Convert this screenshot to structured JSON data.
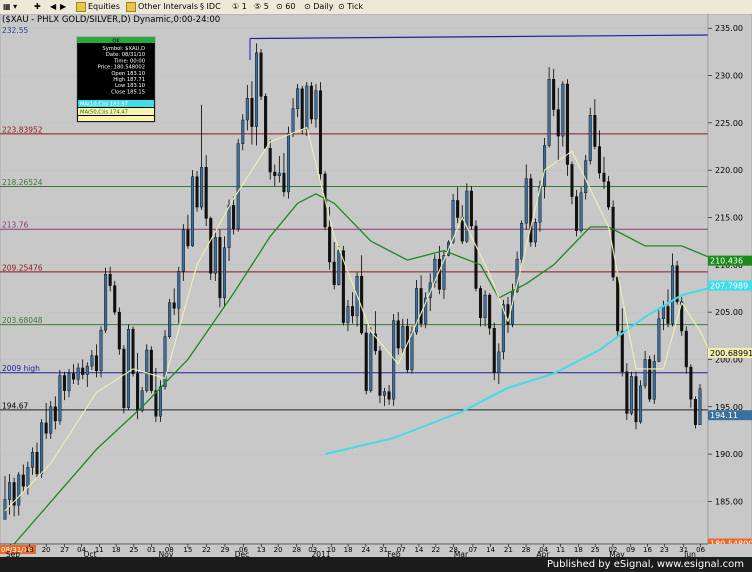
{
  "toolbar": {
    "items": [
      "Equities",
      "Other Intervals",
      "IDC",
      "1",
      "5",
      "60",
      "Daily",
      "Tick"
    ]
  },
  "chart_title": "($XAU - PHLX GOLD/SILVER,D) Dynamic,0:00-24:00",
  "footer": "Published by eSignal, www.esignal.com",
  "colors": {
    "background": "#c8c8c8",
    "up_candle": "#3a6f9e",
    "down_candle": "#111111",
    "ma10": "#f2eeb0",
    "ma50": "#1a8a1a",
    "ma200": "#40dce8",
    "fib_red": "#8b1a1a",
    "fib_green": "#3c7a3c",
    "fib_purple": "#8a3a7a",
    "blue_line": "#2020a0",
    "black_line": "#202020"
  },
  "data_window": {
    "header": "OK",
    "rows": [
      "Symbol: $XAU,D",
      "Date: 08/31/10",
      "Time: 00:00",
      "Price: 180.548002",
      "Open 183.10",
      "High 187.71",
      "Low 183.10",
      "Close 185.15"
    ],
    "ma10_label": "MA(10,C)is 183.97",
    "ma50_label": "MA(50,C)is 174.47"
  },
  "chart_data": {
    "type": "candlestick",
    "y_range": [
      180.5,
      236.5
    ],
    "y_ticks": [
      "185.00",
      "190.00",
      "195.00",
      "200.00",
      "205.00",
      "210.00",
      "215.00",
      "220.00",
      "225.00",
      "230.00",
      "235.00"
    ],
    "x_day_labels": [
      "08/31/10",
      "13",
      "20",
      "27",
      "04",
      "11",
      "18",
      "25",
      "01",
      "08",
      "15",
      "22",
      "29",
      "06",
      "13",
      "20",
      "28",
      "03",
      "10",
      "18",
      "24",
      "31",
      "07",
      "14",
      "22",
      "28",
      "07",
      "14",
      "21",
      "28",
      "04",
      "11",
      "18",
      "25",
      "02",
      "09",
      "16",
      "23",
      "31",
      "06"
    ],
    "x_month_labels": [
      "Sep",
      "Oct",
      "Nov",
      "Dec",
      "2011",
      "Feb",
      "Mar",
      "Apr",
      "May",
      "Jun"
    ],
    "horizontal_lines": [
      {
        "label": "223.83952",
        "value": 223.84,
        "kind": "fib_red"
      },
      {
        "label": "218.26524",
        "value": 218.27,
        "kind": "fib_green"
      },
      {
        "label": "213.76",
        "value": 213.76,
        "kind": "fib_purple"
      },
      {
        "label": "209.25476",
        "value": 209.25,
        "kind": "fib_red"
      },
      {
        "label": "203.68048",
        "value": 203.68,
        "kind": "fib_green"
      },
      {
        "label": "2009 high",
        "value": 198.6,
        "kind": "blue_line"
      },
      {
        "label": "194.67",
        "value": 194.67,
        "kind": "black_line"
      }
    ],
    "top_label": "232.55",
    "right_price_labels": [
      {
        "label": "210.436",
        "value": 210.44,
        "kind": "ma50"
      },
      {
        "label": "207.7989",
        "value": 207.8,
        "kind": "ma200"
      },
      {
        "label": "200.68991",
        "value": 200.69,
        "kind": "ma10"
      },
      {
        "label": "194.11",
        "value": 194.11,
        "kind": "up_candle"
      },
      {
        "label": "180.548002",
        "value": 180.55,
        "kind": "current"
      }
    ],
    "candles": [
      [
        183.1,
        187.7,
        183.1,
        185.2
      ],
      [
        185.2,
        187.9,
        183.6,
        187.0
      ],
      [
        187.0,
        187.5,
        183.4,
        184.6
      ],
      [
        184.6,
        188.1,
        183.5,
        187.8
      ],
      [
        187.8,
        188.9,
        186.0,
        186.6
      ],
      [
        186.6,
        189.2,
        185.7,
        188.6
      ],
      [
        188.6,
        190.7,
        187.8,
        190.2
      ],
      [
        190.2,
        191.2,
        187.4,
        187.9
      ],
      [
        187.9,
        193.7,
        187.5,
        193.3
      ],
      [
        193.3,
        195.4,
        191.6,
        192.2
      ],
      [
        192.2,
        195.6,
        191.6,
        195.0
      ],
      [
        195.0,
        196.1,
        192.6,
        193.5
      ],
      [
        193.5,
        198.9,
        193.1,
        198.3
      ],
      [
        198.3,
        198.7,
        195.7,
        196.7
      ],
      [
        196.7,
        199.0,
        196.0,
        198.5
      ],
      [
        198.5,
        199.5,
        197.4,
        197.9
      ],
      [
        197.9,
        199.6,
        197.3,
        199.1
      ],
      [
        199.1,
        200.0,
        197.9,
        198.4
      ],
      [
        198.4,
        199.7,
        197.1,
        199.3
      ],
      [
        199.3,
        201.0,
        198.9,
        200.4
      ],
      [
        200.4,
        201.6,
        198.1,
        198.8
      ],
      [
        198.8,
        203.5,
        198.1,
        203.1
      ],
      [
        203.1,
        209.7,
        202.8,
        209.0
      ],
      [
        209.0,
        209.8,
        207.2,
        207.8
      ],
      [
        207.8,
        208.3,
        204.7,
        205.0
      ],
      [
        205.0,
        205.5,
        200.5,
        201.1
      ],
      [
        201.1,
        201.5,
        194.3,
        194.9
      ],
      [
        194.9,
        203.7,
        194.7,
        203.2
      ],
      [
        203.2,
        203.5,
        198.2,
        198.5
      ],
      [
        198.5,
        200.7,
        193.7,
        194.6
      ],
      [
        194.6,
        197.1,
        194.4,
        196.7
      ],
      [
        196.7,
        201.6,
        196.5,
        201.0
      ],
      [
        201.0,
        201.4,
        196.4,
        196.7
      ],
      [
        196.7,
        199.1,
        193.4,
        194.0
      ],
      [
        194.0,
        197.8,
        193.4,
        197.1
      ],
      [
        197.1,
        203.1,
        196.8,
        202.4
      ],
      [
        202.4,
        206.4,
        202.2,
        206.0
      ],
      [
        206.0,
        207.5,
        204.7,
        205.4
      ],
      [
        205.4,
        209.8,
        203.8,
        209.3
      ],
      [
        209.3,
        214.3,
        208.3,
        213.7
      ],
      [
        213.7,
        215.3,
        211.7,
        212.0
      ],
      [
        212.0,
        220.0,
        211.9,
        219.3
      ],
      [
        219.3,
        219.9,
        215.6,
        216.1
      ],
      [
        216.1,
        226.9,
        215.8,
        220.3
      ],
      [
        220.3,
        221.6,
        214.1,
        214.9
      ],
      [
        214.9,
        215.1,
        208.4,
        209.1
      ],
      [
        209.1,
        213.7,
        208.3,
        212.9
      ],
      [
        212.9,
        213.7,
        205.5,
        206.5
      ],
      [
        206.5,
        213.0,
        205.5,
        211.8
      ],
      [
        211.8,
        216.9,
        210.4,
        216.3
      ],
      [
        216.3,
        217.2,
        213.2,
        213.8
      ],
      [
        213.8,
        223.3,
        213.5,
        222.8
      ],
      [
        222.8,
        225.9,
        222.1,
        225.3
      ],
      [
        225.3,
        229.0,
        224.2,
        227.6
      ],
      [
        227.6,
        229.4,
        222.7,
        224.6
      ],
      [
        224.6,
        233.4,
        222.6,
        232.4
      ],
      [
        232.4,
        232.8,
        227.4,
        227.8
      ],
      [
        227.8,
        228.1,
        222.2,
        222.3
      ],
      [
        222.3,
        223.2,
        219.0,
        219.8
      ],
      [
        219.8,
        220.6,
        218.3,
        219.4
      ],
      [
        219.4,
        221.5,
        218.7,
        219.7
      ],
      [
        219.7,
        221.8,
        217.2,
        217.7
      ],
      [
        217.7,
        224.6,
        217.0,
        223.9
      ],
      [
        223.9,
        227.6,
        223.5,
        226.5
      ],
      [
        226.5,
        229.1,
        225.6,
        228.6
      ],
      [
        228.6,
        228.9,
        223.8,
        224.3
      ],
      [
        224.3,
        229.3,
        223.6,
        228.9
      ],
      [
        228.9,
        229.3,
        224.9,
        225.4
      ],
      [
        225.4,
        229.1,
        224.5,
        228.4
      ],
      [
        228.4,
        229.3,
        218.7,
        219.6
      ],
      [
        219.6,
        219.9,
        213.7,
        214.0
      ],
      [
        214.0,
        216.1,
        209.5,
        210.3
      ],
      [
        210.3,
        212.4,
        207.4,
        207.9
      ],
      [
        207.9,
        212.0,
        207.8,
        211.5
      ],
      [
        211.5,
        212.0,
        203.6,
        203.9
      ],
      [
        203.9,
        206.3,
        203.0,
        205.6
      ],
      [
        205.6,
        207.1,
        203.8,
        204.6
      ],
      [
        204.6,
        209.2,
        203.5,
        208.8
      ],
      [
        208.8,
        211.0,
        202.6,
        202.8
      ],
      [
        202.8,
        203.7,
        196.3,
        196.7
      ],
      [
        196.7,
        203.4,
        196.5,
        202.7
      ],
      [
        202.7,
        205.1,
        200.5,
        200.9
      ],
      [
        200.9,
        201.4,
        195.4,
        196.2
      ],
      [
        196.2,
        197.0,
        195.1,
        196.6
      ],
      [
        196.6,
        197.3,
        195.2,
        195.8
      ],
      [
        195.8,
        204.8,
        195.1,
        204.1
      ],
      [
        204.1,
        205.0,
        200.5,
        201.2
      ],
      [
        201.2,
        204.3,
        200.6,
        203.5
      ],
      [
        203.5,
        204.3,
        198.6,
        198.9
      ],
      [
        198.9,
        203.5,
        198.5,
        202.9
      ],
      [
        202.9,
        208.4,
        202.6,
        207.5
      ],
      [
        207.5,
        208.9,
        203.4,
        203.8
      ],
      [
        203.8,
        207.1,
        203.3,
        206.5
      ],
      [
        206.5,
        209.1,
        205.1,
        208.1
      ],
      [
        208.1,
        211.1,
        207.6,
        210.6
      ],
      [
        210.6,
        212.0,
        206.9,
        207.4
      ],
      [
        207.4,
        211.4,
        206.4,
        211.0
      ],
      [
        211.0,
        212.6,
        210.9,
        212.4
      ],
      [
        212.4,
        217.5,
        212.2,
        216.8
      ],
      [
        216.8,
        218.2,
        214.4,
        215.0
      ],
      [
        215.0,
        216.3,
        212.2,
        212.5
      ],
      [
        212.5,
        218.6,
        212.3,
        217.8
      ],
      [
        217.8,
        218.3,
        213.7,
        214.1
      ],
      [
        214.1,
        214.7,
        207.2,
        207.5
      ],
      [
        207.5,
        207.8,
        203.5,
        204.4
      ],
      [
        204.4,
        207.3,
        203.5,
        206.8
      ],
      [
        206.8,
        207.0,
        202.6,
        203.3
      ],
      [
        203.3,
        203.9,
        197.8,
        198.6
      ],
      [
        198.6,
        201.7,
        197.4,
        200.8
      ],
      [
        200.8,
        206.3,
        200.0,
        205.8
      ],
      [
        205.8,
        206.6,
        202.8,
        203.7
      ],
      [
        203.7,
        208.0,
        203.4,
        207.2
      ],
      [
        207.2,
        211.4,
        207.0,
        210.6
      ],
      [
        210.6,
        214.7,
        209.9,
        214.4
      ],
      [
        214.4,
        220.6,
        213.7,
        219.1
      ],
      [
        219.1,
        219.6,
        211.9,
        212.4
      ],
      [
        212.4,
        214.9,
        211.9,
        214.5
      ],
      [
        214.5,
        218.9,
        213.5,
        218.3
      ],
      [
        218.3,
        223.4,
        217.0,
        222.6
      ],
      [
        222.6,
        230.9,
        222.4,
        229.6
      ],
      [
        229.6,
        230.7,
        225.7,
        226.4
      ],
      [
        226.4,
        228.7,
        220.9,
        223.6
      ],
      [
        223.6,
        229.4,
        222.5,
        229.1
      ],
      [
        229.1,
        229.6,
        219.4,
        220.6
      ],
      [
        220.6,
        220.9,
        216.4,
        217.2
      ],
      [
        217.2,
        217.9,
        213.0,
        213.6
      ],
      [
        213.6,
        218.2,
        213.4,
        217.6
      ],
      [
        217.6,
        221.6,
        216.9,
        221.0
      ],
      [
        221.0,
        226.6,
        220.6,
        225.8
      ],
      [
        225.8,
        227.5,
        222.2,
        222.5
      ],
      [
        222.5,
        224.2,
        219.1,
        219.7
      ],
      [
        219.7,
        221.4,
        218.0,
        218.8
      ],
      [
        218.8,
        219.4,
        215.8,
        216.1
      ],
      [
        216.1,
        216.8,
        208.3,
        208.7
      ],
      [
        208.7,
        209.1,
        202.4,
        203.0
      ],
      [
        203.0,
        205.4,
        198.2,
        198.7
      ],
      [
        198.7,
        199.6,
        193.6,
        194.3
      ],
      [
        194.3,
        198.7,
        194.1,
        198.2
      ],
      [
        198.2,
        198.7,
        192.6,
        193.4
      ],
      [
        193.4,
        197.8,
        193.2,
        197.2
      ],
      [
        197.2,
        200.9,
        196.9,
        200.0
      ],
      [
        200.0,
        200.4,
        195.5,
        195.8
      ],
      [
        195.8,
        200.5,
        195.3,
        199.8
      ],
      [
        199.8,
        205.2,
        199.7,
        204.3
      ],
      [
        204.3,
        206.2,
        203.1,
        205.6
      ],
      [
        205.6,
        207.4,
        203.4,
        203.8
      ],
      [
        203.8,
        211.2,
        203.5,
        209.9
      ],
      [
        209.9,
        210.4,
        205.8,
        206.1
      ],
      [
        206.1,
        206.6,
        202.5,
        203.0
      ],
      [
        203.0,
        203.5,
        198.5,
        199.2
      ],
      [
        199.2,
        199.5,
        194.9,
        195.8
      ],
      [
        195.8,
        196.1,
        192.7,
        193.1
      ],
      [
        193.1,
        197.4,
        193.1,
        196.9
      ]
    ],
    "ma10": [
      [
        0,
        184.0
      ],
      [
        10,
        189.0
      ],
      [
        20,
        196.5
      ],
      [
        28,
        199.0
      ],
      [
        35,
        198.0
      ],
      [
        42,
        210.0
      ],
      [
        50,
        217.0
      ],
      [
        58,
        223.0
      ],
      [
        66,
        224.5
      ],
      [
        72,
        213.0
      ],
      [
        80,
        203.0
      ],
      [
        86,
        199.5
      ],
      [
        92,
        206.0
      ],
      [
        100,
        215.0
      ],
      [
        106,
        209.0
      ],
      [
        110,
        204.0
      ],
      [
        114,
        212.0
      ],
      [
        118,
        220.0
      ],
      [
        124,
        222.0
      ],
      [
        132,
        214.0
      ],
      [
        138,
        199.0
      ],
      [
        144,
        199.0
      ],
      [
        148,
        206.0
      ],
      [
        152,
        203.0
      ],
      [
        156,
        199.0
      ]
    ],
    "ma50": [
      [
        2,
        180.5
      ],
      [
        20,
        190.5
      ],
      [
        30,
        195.0
      ],
      [
        40,
        200.0
      ],
      [
        50,
        207.0
      ],
      [
        58,
        213.0
      ],
      [
        64,
        216.5
      ],
      [
        68,
        217.5
      ],
      [
        72,
        216.5
      ],
      [
        80,
        212.5
      ],
      [
        88,
        210.5
      ],
      [
        96,
        211.5
      ],
      [
        104,
        210.0
      ],
      [
        108,
        206.5
      ],
      [
        114,
        208.0
      ],
      [
        120,
        210.0
      ],
      [
        128,
        214.0
      ],
      [
        132,
        214.0
      ],
      [
        140,
        212.0
      ],
      [
        148,
        212.0
      ],
      [
        156,
        210.4
      ]
    ],
    "ma200": [
      [
        70,
        190.0
      ],
      [
        85,
        191.7
      ],
      [
        100,
        194.5
      ],
      [
        110,
        197.0
      ],
      [
        120,
        198.5
      ],
      [
        130,
        201.0
      ],
      [
        140,
        204.5
      ],
      [
        148,
        206.8
      ],
      [
        156,
        207.8
      ]
    ]
  }
}
